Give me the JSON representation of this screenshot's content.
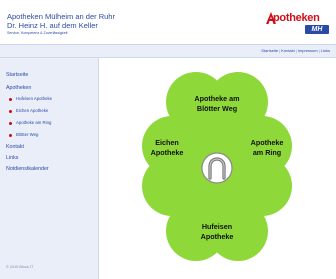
{
  "header": {
    "title_line1": "Apotheken Mülheim an der Ruhr",
    "title_line2": "Dr. Heinz H. auf dem Keller",
    "tagline": "Service, Kompetenz & Zuverlässigkeit"
  },
  "logo": {
    "text": "potheken",
    "letter": "A",
    "badge": "MH"
  },
  "toplinks": [
    "Startseite",
    "Kontakt",
    "Impressum",
    "Links"
  ],
  "sidebar": {
    "items": [
      {
        "label": "Startseite"
      },
      {
        "label": "Apotheken"
      },
      {
        "label": "Hufeisen Apotheke"
      },
      {
        "label": "Eichen Apotheke"
      },
      {
        "label": "Apotheke am Ring"
      },
      {
        "label": "Blötter Weg"
      },
      {
        "label": "Kontakt"
      },
      {
        "label": "Links"
      },
      {
        "label": "Notdienstkalender"
      }
    ],
    "copyright": "© 2010 Block-IT"
  },
  "clover": {
    "top": [
      "Apotheke am",
      "Blötter Weg"
    ],
    "left": [
      "Eichen",
      "Apotheke"
    ],
    "right": [
      "Apotheke",
      "am Ring"
    ],
    "bottom": [
      "Hufeisen",
      "Apotheke"
    ]
  },
  "colors": {
    "brand_blue": "#2b4aa8",
    "brand_red": "#d0101a",
    "clover_green": "#8ed83a",
    "nav_background": "#e9eef8"
  }
}
